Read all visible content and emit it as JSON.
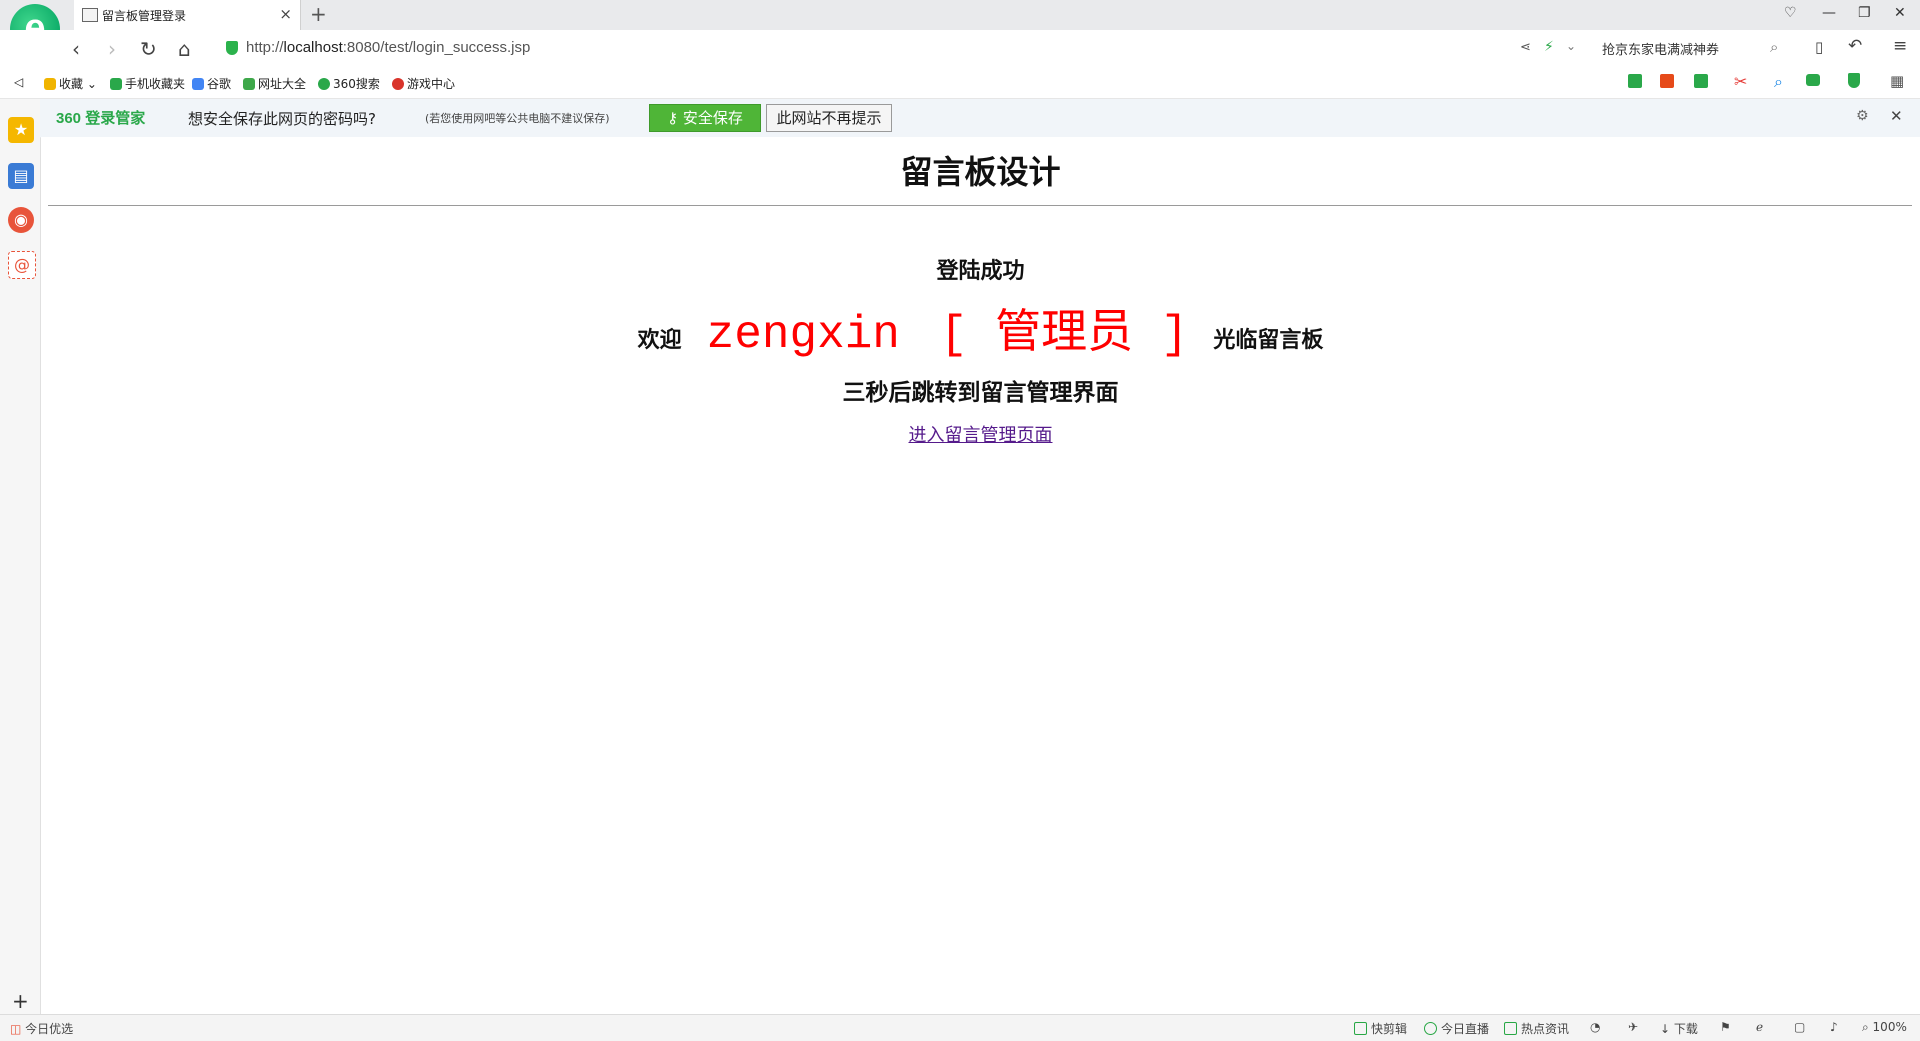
{
  "tab": {
    "title": "留言板管理登录"
  },
  "address": {
    "url_prefix": "http://",
    "url_host": "localhost",
    "url_rest": ":8080/test/login_success.jsp",
    "search_suggestion": "抢京东家电满减神券"
  },
  "bookmarks": [
    {
      "label": "收藏",
      "color": "#f0b400"
    },
    {
      "label": "手机收藏夹",
      "color": "#2aa84a"
    },
    {
      "label": "谷歌",
      "color": "#4285f4"
    },
    {
      "label": "网址大全",
      "color": "#3ea84a"
    },
    {
      "label": "360搜索",
      "color": "#2aa84a"
    },
    {
      "label": "游戏中心",
      "color": "#d9342b"
    }
  ],
  "password_bar": {
    "brand": "360 登录管家",
    "question": "想安全保存此网页的密码吗?",
    "note": "(若您使用网吧等公共电脑不建议保存)",
    "save_label": "安全保存",
    "never_label": "此网站不再提示"
  },
  "page": {
    "title": "留言板设计",
    "success": "登陆成功",
    "welcome_prefix": "欢迎",
    "username": "zengxin",
    "role": "[ 管理员 ]",
    "welcome_suffix": "光临留言板",
    "redirect_msg": "三秒后跳转到留言管理界面",
    "entry_link": "进入留言管理页面"
  },
  "statusbar": {
    "left": "今日优选",
    "items": [
      "快剪辑",
      "今日直播",
      "热点资讯",
      "下载"
    ],
    "zoom": "100%"
  },
  "colors": {
    "accent_green": "#4fb537",
    "highlight_red": "#ff0000",
    "link_visited": "#551a8b"
  }
}
